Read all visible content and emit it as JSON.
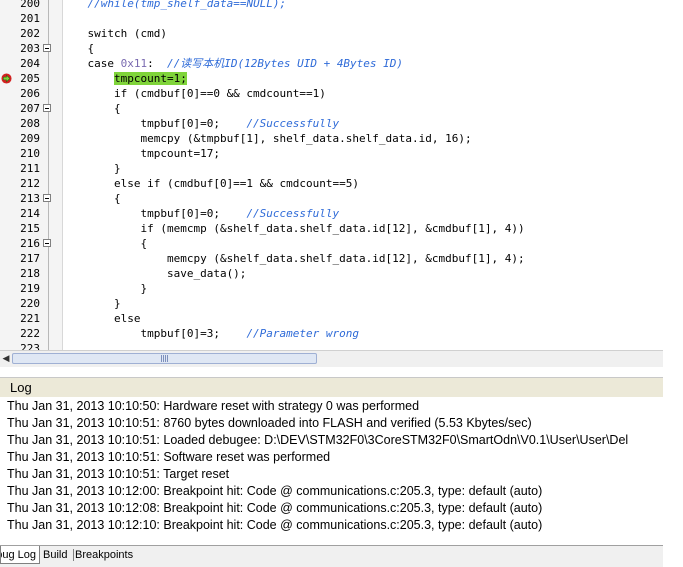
{
  "editor": {
    "lines": [
      {
        "num": "200",
        "fold": false,
        "bp": false,
        "parts": [
          {
            "t": "    "
          },
          {
            "t": "//while(tmp_shelf_data==NULL);",
            "c": "cm"
          }
        ]
      },
      {
        "num": "201",
        "fold": false,
        "bp": false,
        "parts": [
          {
            "t": ""
          }
        ]
      },
      {
        "num": "202",
        "fold": false,
        "bp": false,
        "parts": [
          {
            "t": "    switch (cmd)"
          }
        ]
      },
      {
        "num": "203",
        "fold": true,
        "bp": false,
        "parts": [
          {
            "t": "    {"
          }
        ]
      },
      {
        "num": "204",
        "fold": false,
        "bp": false,
        "parts": [
          {
            "t": "    case "
          },
          {
            "t": "0x11",
            "c": "hx"
          },
          {
            "t": ":  "
          },
          {
            "t": "//读写本机ID(12Bytes UID + 4Bytes ID)",
            "c": "cm"
          }
        ]
      },
      {
        "num": "205",
        "fold": false,
        "bp": true,
        "parts": [
          {
            "t": "        "
          },
          {
            "t": "tmpcount=1;",
            "c": "hl"
          }
        ]
      },
      {
        "num": "206",
        "fold": false,
        "bp": false,
        "parts": [
          {
            "t": "        if (cmdbuf[0]==0 && cmdcount==1)"
          }
        ]
      },
      {
        "num": "207",
        "fold": true,
        "bp": false,
        "parts": [
          {
            "t": "        {"
          }
        ]
      },
      {
        "num": "208",
        "fold": false,
        "bp": false,
        "parts": [
          {
            "t": "            tmpbuf[0]=0;    "
          },
          {
            "t": "//Successfully",
            "c": "cm"
          }
        ]
      },
      {
        "num": "209",
        "fold": false,
        "bp": false,
        "parts": [
          {
            "t": "            memcpy (&tmpbuf[1], shelf_data.shelf_data.id, 16);"
          }
        ]
      },
      {
        "num": "210",
        "fold": false,
        "bp": false,
        "parts": [
          {
            "t": "            tmpcount=17;"
          }
        ]
      },
      {
        "num": "211",
        "fold": false,
        "bp": false,
        "parts": [
          {
            "t": "        }"
          }
        ]
      },
      {
        "num": "212",
        "fold": false,
        "bp": false,
        "parts": [
          {
            "t": "        else if (cmdbuf[0]==1 && cmdcount==5)"
          }
        ]
      },
      {
        "num": "213",
        "fold": true,
        "bp": false,
        "parts": [
          {
            "t": "        {"
          }
        ]
      },
      {
        "num": "214",
        "fold": false,
        "bp": false,
        "parts": [
          {
            "t": "            tmpbuf[0]=0;    "
          },
          {
            "t": "//Successfully",
            "c": "cm"
          }
        ]
      },
      {
        "num": "215",
        "fold": false,
        "bp": false,
        "parts": [
          {
            "t": "            if (memcmp (&shelf_data.shelf_data.id[12], &cmdbuf[1], 4))"
          }
        ]
      },
      {
        "num": "216",
        "fold": true,
        "bp": false,
        "parts": [
          {
            "t": "            {"
          }
        ]
      },
      {
        "num": "217",
        "fold": false,
        "bp": false,
        "parts": [
          {
            "t": "                memcpy (&shelf_data.shelf_data.id[12], &cmdbuf[1], 4);"
          }
        ]
      },
      {
        "num": "218",
        "fold": false,
        "bp": false,
        "parts": [
          {
            "t": "                save_data();"
          }
        ]
      },
      {
        "num": "219",
        "fold": false,
        "bp": false,
        "parts": [
          {
            "t": "            }"
          }
        ]
      },
      {
        "num": "220",
        "fold": false,
        "bp": false,
        "parts": [
          {
            "t": "        }"
          }
        ]
      },
      {
        "num": "221",
        "fold": false,
        "bp": false,
        "parts": [
          {
            "t": "        else"
          }
        ]
      },
      {
        "num": "222",
        "fold": false,
        "bp": false,
        "parts": [
          {
            "t": "            tmpbuf[0]=3;    "
          },
          {
            "t": "//Parameter wrong",
            "c": "cm"
          }
        ]
      },
      {
        "num": "223",
        "fold": false,
        "bp": false,
        "parts": [
          {
            "t": ""
          }
        ]
      }
    ]
  },
  "log": {
    "title": "Log",
    "entries": [
      "Thu Jan 31, 2013 10:10:50: Hardware reset with strategy 0 was performed",
      "Thu Jan 31, 2013 10:10:51: 8760 bytes downloaded into FLASH and verified (5.53 Kbytes/sec)",
      "Thu Jan 31, 2013 10:10:51: Loaded debugee: D:\\DEV\\STM32F0\\3CoreSTM32F0\\SmartOdn\\V0.1\\User\\User\\Del",
      "Thu Jan 31, 2013 10:10:51: Software reset was performed",
      "Thu Jan 31, 2013 10:10:51: Target reset",
      "Thu Jan 31, 2013 10:12:00: Breakpoint hit: Code @ communications.c:205.3, type: default (auto)",
      "Thu Jan 31, 2013 10:12:08: Breakpoint hit: Code @ communications.c:205.3, type: default (auto)",
      "Thu Jan 31, 2013 10:12:10: Breakpoint hit: Code @ communications.c:205.3, type: default (auto)"
    ]
  },
  "tabs": [
    "Debug Log",
    "Build",
    "Breakpoints"
  ],
  "colors": {
    "comment": "#2f6bd8",
    "hex": "#7a6ab0",
    "highlight": "#7fd43a",
    "breakpoint": "#d42020"
  },
  "icons": {
    "breakpoint": "breakpoint-arrow-icon",
    "fold": "fold-minus-icon",
    "scroll_left": "scroll-left-arrow-icon"
  }
}
